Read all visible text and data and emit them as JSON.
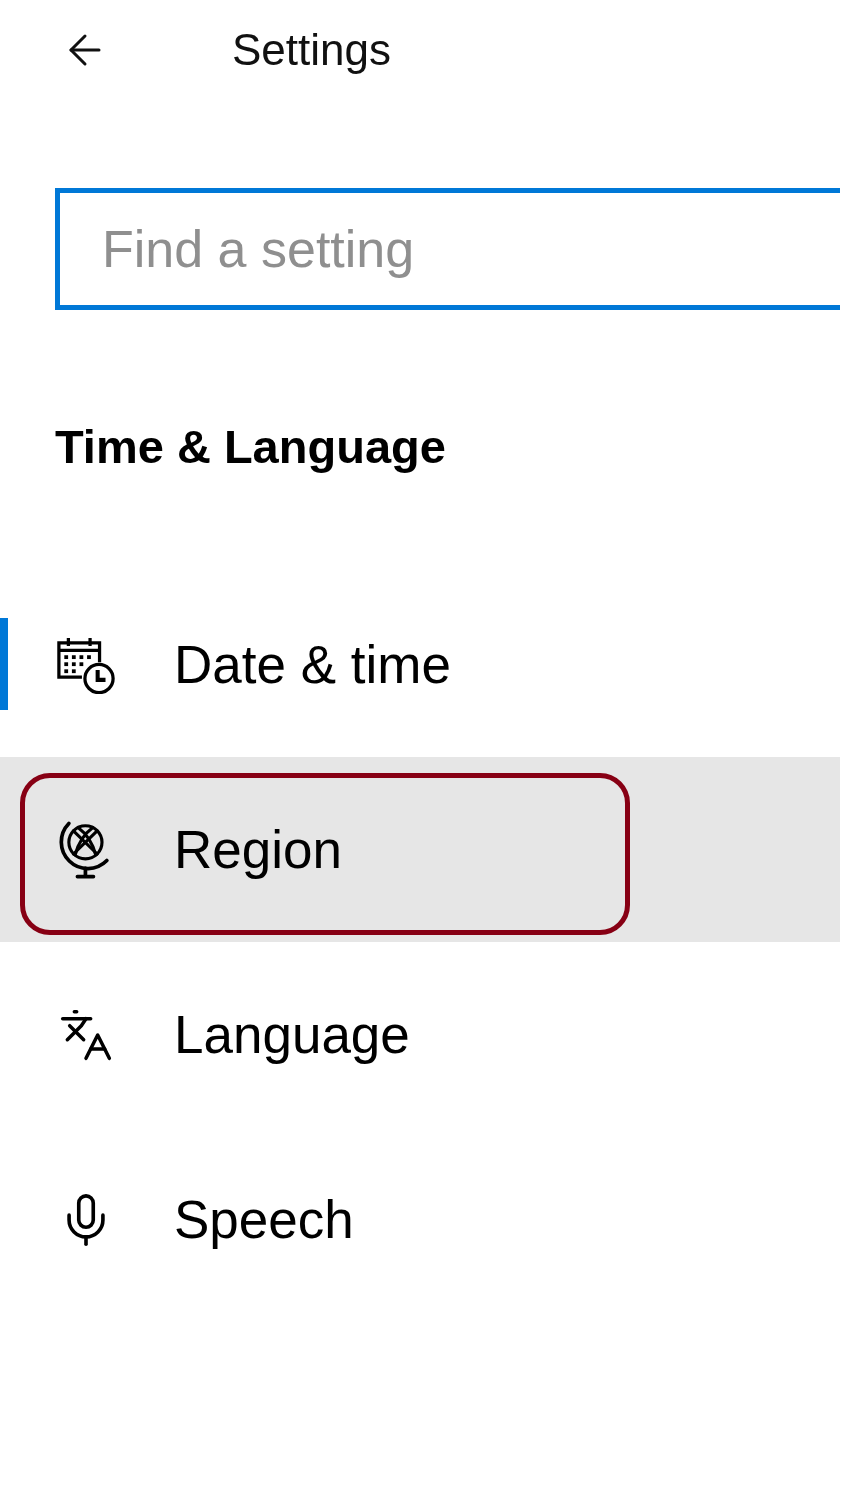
{
  "window": {
    "title": "Settings"
  },
  "search": {
    "placeholder": "Find a setting"
  },
  "section": {
    "title": "Time & Language"
  },
  "nav": {
    "items": [
      {
        "label": "Date & time",
        "selected": true,
        "hovered": false,
        "highlighted": false
      },
      {
        "label": "Region",
        "selected": false,
        "hovered": true,
        "highlighted": true
      },
      {
        "label": "Language",
        "selected": false,
        "hovered": false,
        "highlighted": false
      },
      {
        "label": "Speech",
        "selected": false,
        "hovered": false,
        "highlighted": false
      }
    ]
  }
}
